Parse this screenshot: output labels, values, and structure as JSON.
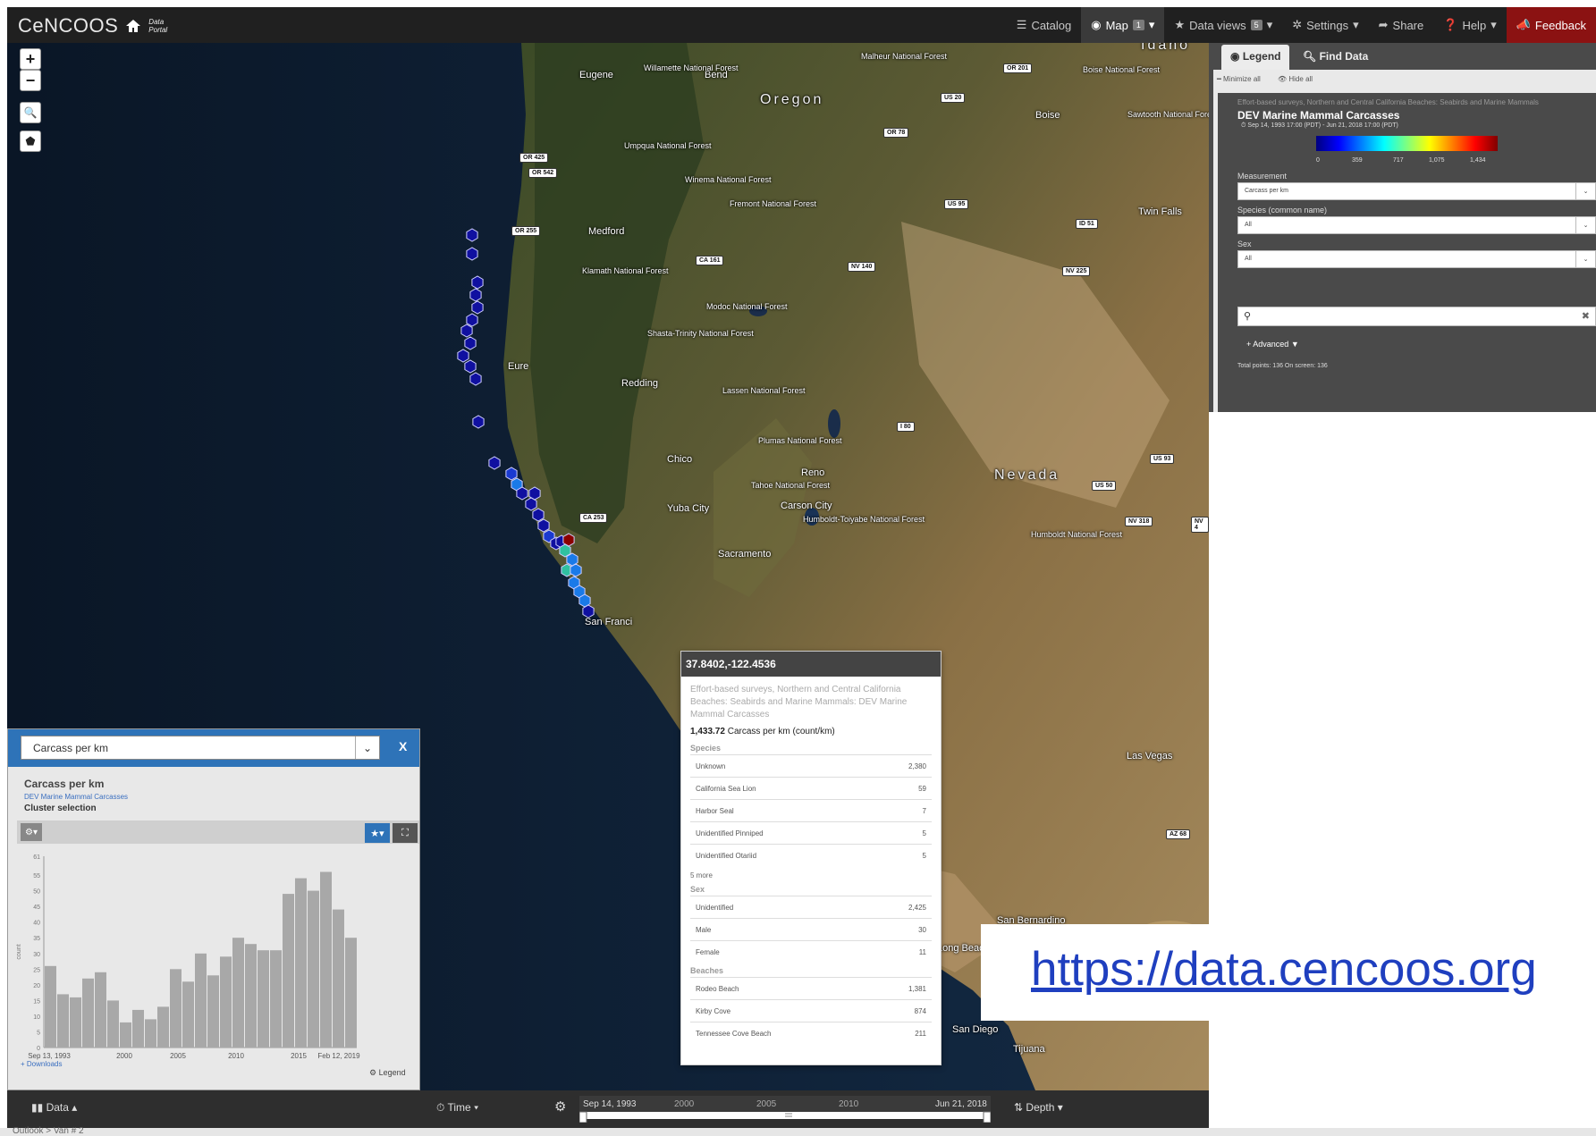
{
  "app": {
    "logo": "CeNCOOS",
    "logo_sub": "Data Portal"
  },
  "nav": [
    {
      "label": "Catalog",
      "icon": "list-icon"
    },
    {
      "label": "Map",
      "icon": "globe-icon",
      "badge": "1",
      "active": true
    },
    {
      "label": "Data views",
      "icon": "star-icon",
      "badge": "5"
    },
    {
      "label": "Settings",
      "icon": "gear-icon"
    },
    {
      "label": "Share",
      "icon": "share-icon"
    },
    {
      "label": "Help",
      "icon": "help-icon"
    },
    {
      "label": "Feedback",
      "icon": "megaphone-icon"
    }
  ],
  "map": {
    "labels": {
      "oregon": "Oregon",
      "nevada": "Nevada",
      "idaho": "Idaho",
      "eugene": "Eugene",
      "bend": "Bend",
      "medford": "Medford",
      "redding": "Redding",
      "chico": "Chico",
      "reno": "Reno",
      "boise": "Boise",
      "twin_falls": "Twin Falls",
      "yuba_city": "Yuba City",
      "carson_city": "Carson City",
      "sacramento": "Sacramento",
      "san_francisco": "San Franci",
      "san_diego": "San Diego",
      "tijuana": "Tijuana",
      "san_bernardino": "San Bernardino",
      "long_beach": "Long Beach",
      "eureka": "Eure",
      "las_vegas": "Las Vegas",
      "willamette": "Willamette National Forest",
      "malheur": "Malheur National Forest",
      "boise_nf": "Boise National Forest",
      "umpqua": "Umpqua National Forest",
      "winema": "Winema National Forest",
      "fremont": "Fremont National Forest",
      "sawtooth": "Sawtooth National Forest",
      "klamath": "Klamath National Forest",
      "modoc": "Modoc National Forest",
      "shasta": "Shasta-Trinity National Forest",
      "lassen": "Lassen National Forest",
      "plumas": "Plumas National Forest",
      "tahoe": "Tahoe National Forest",
      "humboldt": "Humboldt-Toiyabe National Forest",
      "humboldt2": "Humboldt National Forest"
    },
    "shields": [
      "OR 201",
      "US 20",
      "OR 78",
      "OR 425",
      "OR 542",
      "OR 255",
      "US 95",
      "ID 51",
      "CA 161",
      "NV 140",
      "NV 225",
      "I 80",
      "US 93",
      "US 50",
      "NV 318",
      "NV 4",
      "CA 253",
      "AZ 68"
    ],
    "controls": {
      "zoom_in": "+",
      "zoom_out": "−"
    }
  },
  "popup": {
    "coords": "37.8402,-122.4536",
    "description": "Effort-based surveys, Northern and Central California Beaches: Seabirds and Marine Mammals: DEV Marine Mammal Carcasses",
    "value": "1,433.72",
    "value_unit": "Carcass per km (count/km)",
    "species_title": "Species",
    "species": [
      [
        "Unknown",
        "2,380"
      ],
      [
        "California Sea Lion",
        "59"
      ],
      [
        "Harbor Seal",
        "7"
      ],
      [
        "Unidentified Pinniped",
        "5"
      ],
      [
        "Unidentified Otariid",
        "5"
      ]
    ],
    "more": "5 more",
    "sex_title": "Sex",
    "sex": [
      [
        "Unidentified",
        "2,425"
      ],
      [
        "Male",
        "30"
      ],
      [
        "Female",
        "11"
      ]
    ],
    "beaches_title": "Beaches",
    "beaches": [
      [
        "Rodeo Beach",
        "1,381"
      ],
      [
        "Kirby Cove",
        "874"
      ],
      [
        "Tennessee Cove Beach",
        "211"
      ]
    ]
  },
  "legend": {
    "tab_legend": "Legend",
    "tab_find": "Find Data",
    "minimize_all": "Minimize all",
    "hide_all": "Hide all",
    "layer_sub": "Effort-based surveys, Northern and Central California Beaches: Seabirds and Marine Mammals",
    "layer_title": "DEV Marine Mammal Carcasses",
    "layer_dates": "Sep 14, 1993 17:00 (PDT) - Jun 21, 2018 17:00 (PDT)",
    "ticks": [
      "0",
      "359",
      "717",
      "1,075",
      "1,434"
    ],
    "measurement_label": "Measurement",
    "measurement_value": "Carcass per km",
    "species_label": "Species (common name)",
    "species_value": "All",
    "sex_label": "Sex",
    "sex_value": "All",
    "advanced": "+ Advanced",
    "total": "Total points: 136 On screen: 136"
  },
  "chart_panel": {
    "select_value": "Carcass per km",
    "close": "X",
    "title": "Carcass per km",
    "link": "DEV Marine Mammal Carcasses",
    "cluster": "Cluster selection",
    "downloads": "+ Downloads",
    "legend": "Legend"
  },
  "chart_data": {
    "type": "bar",
    "ylabel": "count",
    "xlabel": "Time",
    "ylim": [
      0,
      61
    ],
    "y_ticks": [
      "0",
      "5",
      "10",
      "15",
      "20",
      "25",
      "30",
      "35",
      "40",
      "45",
      "50",
      "55",
      "61"
    ],
    "x_ticks": [
      "Sep 13, 1993",
      "2000",
      "2005",
      "2010",
      "2015",
      "Feb 12, 2019"
    ],
    "values": [
      26,
      17,
      16,
      22,
      24,
      15,
      8,
      12,
      9,
      13,
      25,
      21,
      30,
      23,
      29,
      35,
      33,
      31,
      31,
      49,
      54,
      50,
      56,
      44,
      35
    ]
  },
  "bottom": {
    "data": "Data",
    "time": "Time",
    "depth": "Depth",
    "timeline_start": "Sep 14, 1993",
    "timeline_end": "Jun 21, 2018",
    "timeline_ticks": [
      "2000",
      "2005",
      "2010"
    ]
  },
  "url": "https://data.cencoos.org",
  "strip": "Outlook > Van # 2"
}
